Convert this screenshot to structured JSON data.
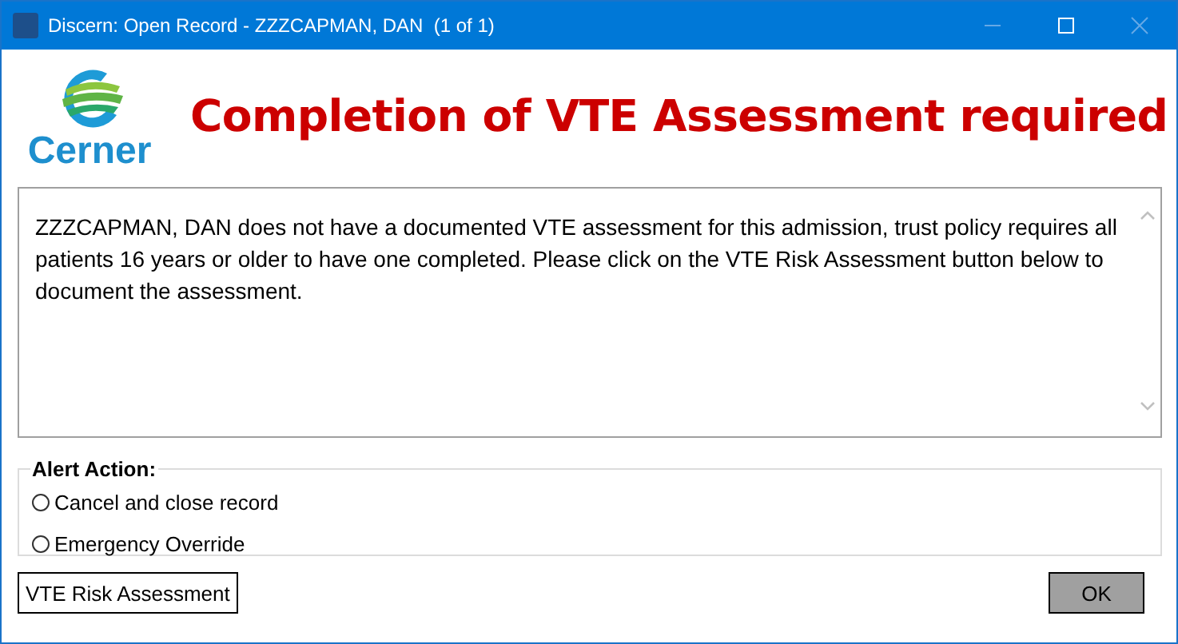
{
  "window": {
    "title": "Discern: Open Record - ZZZCAPMAN, DAN  (1 of 1)",
    "controls": [
      {
        "kind": "minimize",
        "disabled": true
      },
      {
        "kind": "maximize",
        "disabled": false
      },
      {
        "kind": "close",
        "disabled": true
      }
    ]
  },
  "logo": {
    "text": "Cerner"
  },
  "heading": "Completion of VTE Assessment required",
  "message": "ZZZCAPMAN, DAN does not have a documented VTE assessment for this admission, trust policy requires all patients 16 years or older to have one completed. Please click on the VTE Risk Assessment button below to document the assessment.",
  "alert_action": {
    "label": "Alert Action:",
    "options": [
      {
        "label": "Cancel and close record",
        "selected": false
      },
      {
        "label": "Emergency Override",
        "selected": false
      }
    ]
  },
  "buttons": [
    {
      "kind": "left",
      "label": "VTE Risk Assessment"
    },
    {
      "kind": "right",
      "label": "OK"
    }
  ]
}
